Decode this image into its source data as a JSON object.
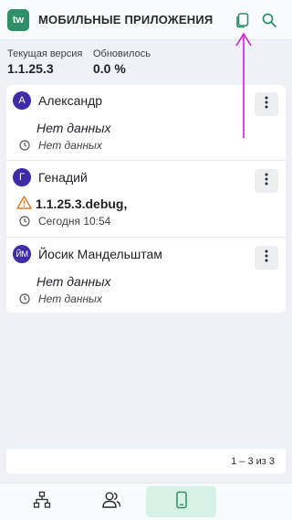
{
  "header": {
    "logo_text": "tw",
    "title": "МОБИЛЬНЫЕ ПРИЛОЖЕНИЯ",
    "copy_icon": "copy-icon",
    "search_icon": "search-icon"
  },
  "stats": {
    "current_version_label": "Текущая версия",
    "current_version_value": "1.1.25.3",
    "updated_label": "Обновилось",
    "updated_value": "0.0 %"
  },
  "users": [
    {
      "initial": "А",
      "name": "Александр",
      "version": "Нет данных",
      "version_warning": false,
      "time": "Нет данных"
    },
    {
      "initial": "Г",
      "name": "Генадий",
      "version": "1.1.25.3.debug,",
      "version_warning": true,
      "time": "Сегодня 10:54"
    },
    {
      "initial": "ЙМ",
      "name": "Йосик Мандельштам",
      "version": "Нет данных",
      "version_warning": false,
      "time": "Нет данных"
    }
  ],
  "pagination": {
    "text": "1 – 3 из 3"
  },
  "bottom_nav": [
    {
      "icon": "hierarchy-icon",
      "active": false
    },
    {
      "icon": "users-icon",
      "active": false
    },
    {
      "icon": "mobile-phone-icon",
      "active": true
    }
  ],
  "colors": {
    "brand": "#2f8f68",
    "avatar": "#3f2aa8",
    "warning": "#e07a2f",
    "annotation_arrow": "#d11fd8",
    "active_tab": "#d6f2e6"
  }
}
